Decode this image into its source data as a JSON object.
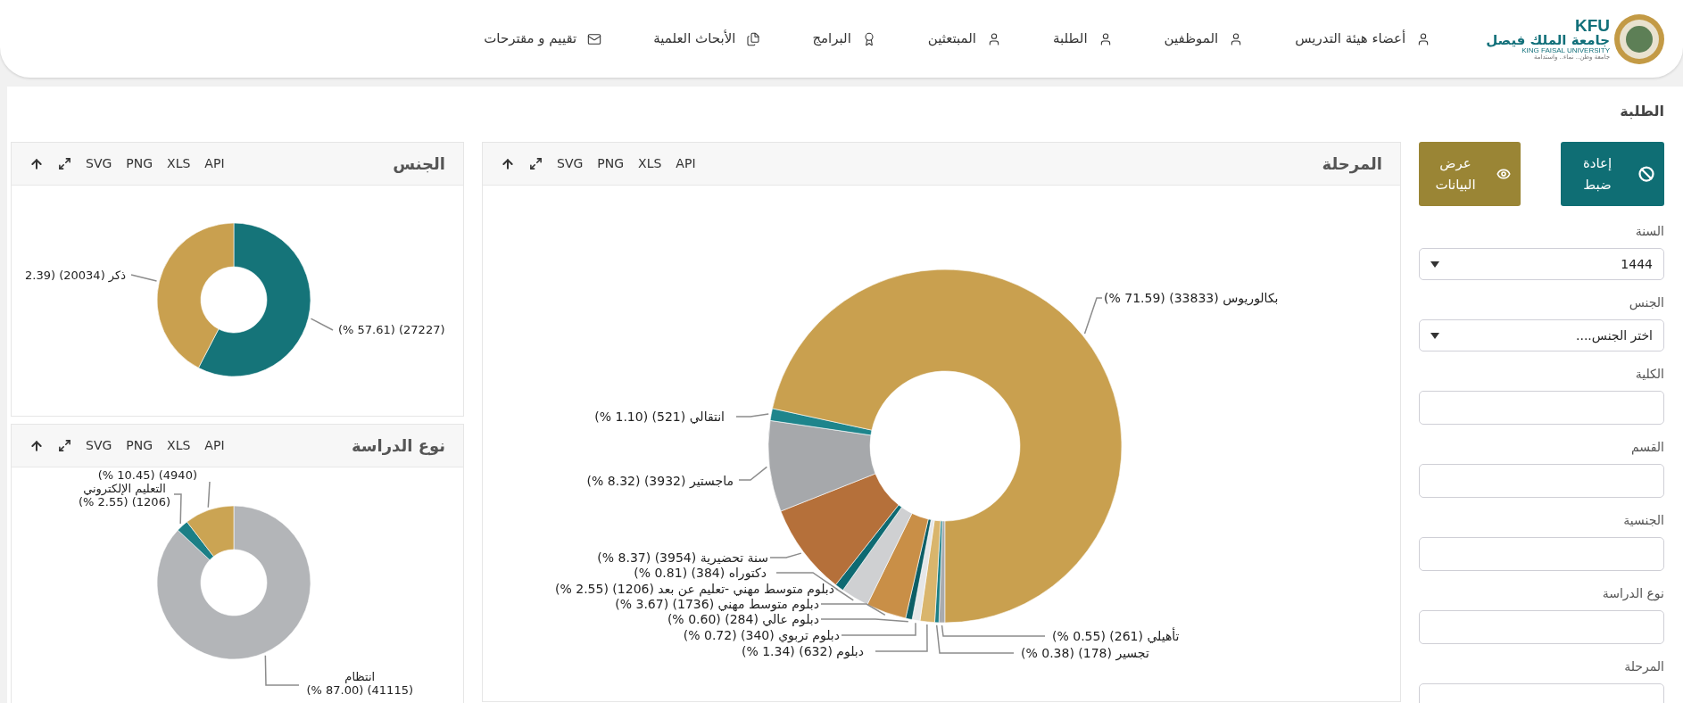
{
  "header": {
    "logo": {
      "abbr": "KFU",
      "name_ar": "جامعة الملك فيصل",
      "name_en": "KING FAISAL UNIVERSITY",
      "tagline": "جامعة وطن.. نماء.. واستدامة"
    },
    "nav": [
      {
        "label": "أعضاء هيئة التدريس",
        "kind": "user"
      },
      {
        "label": "الموظفين",
        "kind": "user"
      },
      {
        "label": "الطلبة",
        "kind": "user"
      },
      {
        "label": "المبتعثين",
        "kind": "user"
      },
      {
        "label": "البرامج",
        "kind": "award"
      },
      {
        "label": "الأبحاث العلمية",
        "kind": "docs"
      },
      {
        "label": "تقييم و مقترحات",
        "kind": "mail"
      }
    ]
  },
  "page_title": "الطلبة",
  "filters": {
    "buttons": [
      {
        "label": "إعادة ضبط",
        "kind": "reset"
      },
      {
        "label": "عرض البيانات",
        "kind": "view"
      }
    ],
    "fields": [
      {
        "label": "السنة",
        "kind": "select",
        "value": "1444"
      },
      {
        "label": "الجنس",
        "kind": "select",
        "placeholder": "اختر الجنس...."
      },
      {
        "label": "الكلية",
        "kind": "input"
      },
      {
        "label": "القسم",
        "kind": "input"
      },
      {
        "label": "الجنسية",
        "kind": "input"
      },
      {
        "label": "نوع الدراسة",
        "kind": "input"
      },
      {
        "label": "المرحلة",
        "kind": "input"
      }
    ]
  },
  "panels": [
    {
      "title": "المرحلة",
      "toolbar": [
        "API",
        "XLS",
        "PNG",
        "SVG"
      ],
      "chart_data": {
        "type": "donut",
        "values": [
          261,
          178,
          632,
          340,
          284,
          1736,
          1206,
          384,
          3954,
          3932,
          521,
          33833
        ],
        "value_labels": [
          "تأهيلي (261) (0.55 %)",
          "تجسير (178) (0.38 %)",
          "دبلوم (632) (1.34 %)",
          "دبلوم تربوي (340) (0.72 %)",
          "دبلوم عالي (284) (0.60 %)",
          "دبلوم متوسط مهني (1736) (3.67 %)",
          "دبلوم متوسط مهني -تعليم عن بعد (1206) (2.55 %)",
          "دكتوراه (384) (0.81 %)",
          "سنة تحضيرية (3954) (8.37 %)",
          "ماجستير (3932) (8.32 %)",
          "انتقالي (521) (1.10 %)",
          "بكالوريوس (33833) (71.59 %)"
        ]
      }
    },
    {
      "title": "الجنس",
      "toolbar": [
        "API",
        "XLS",
        "PNG",
        "SVG"
      ],
      "chart_data": {
        "type": "donut",
        "values": [
          27227,
          20034
        ],
        "value_labels": [
          "(27227) (57.61 %)",
          "ذكر (20034) (2.39"
        ]
      }
    },
    {
      "title": "نوع الدراسة",
      "toolbar": [
        "API",
        "XLS",
        "PNG",
        "SVG"
      ],
      "chart_data": {
        "type": "donut",
        "values": [
          41115,
          1206,
          4940
        ],
        "value_labels": [
          "انتظام\n(41115) (87.00 %)",
          "التعليم الإلكتروني\n(1206) (2.55 %)",
          "(4940) (10.45 %)"
        ]
      }
    }
  ]
}
